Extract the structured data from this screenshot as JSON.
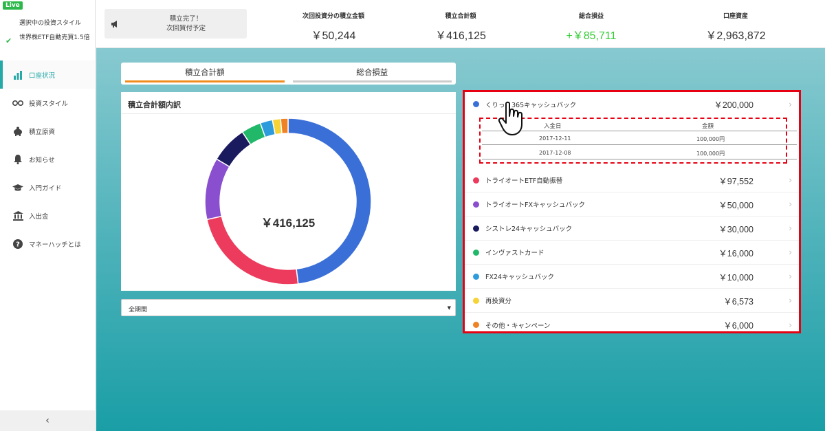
{
  "sidebar": {
    "live_badge": "Live",
    "style_label": "選択中の投資スタイル",
    "style_value": "世界株ETF自動売買1.5倍",
    "items": [
      {
        "label": "口座状況",
        "icon": "bar-chart-icon",
        "active": true
      },
      {
        "label": "投資スタイル",
        "icon": "glasses-icon"
      },
      {
        "label": "積立原資",
        "icon": "piggy-bank-icon"
      },
      {
        "label": "お知らせ",
        "icon": "bell-icon"
      },
      {
        "label": "入門ガイド",
        "icon": "graduation-cap-icon"
      },
      {
        "label": "入出金",
        "icon": "bank-icon"
      },
      {
        "label": "マネーハッチとは",
        "icon": "question-icon"
      }
    ],
    "collapse_glyph": "‹"
  },
  "header": {
    "notice_line1": "積立完了！",
    "notice_line2": "次回買付予定",
    "stats": [
      {
        "label": "次回投資分の積立金額",
        "value": "￥50,244"
      },
      {
        "label": "積立合計額",
        "value": "￥416,125"
      },
      {
        "label": "総合損益",
        "value": "+￥85,711",
        "color": "#33cc33"
      },
      {
        "label": "口座資産",
        "value": "￥2,963,872"
      }
    ]
  },
  "tabs": [
    {
      "label": "積立合計額",
      "active": true
    },
    {
      "label": "総合損益",
      "active": false
    }
  ],
  "chart_title": "積立合計額内訳",
  "period_select": {
    "value": "全期間"
  },
  "chart_data": {
    "type": "pie",
    "center_label": "￥416,125",
    "categories": [
      "くりっく365キャッシュバック",
      "トライオートETF自動振替",
      "トライオートFXキャッシュバック",
      "シストレ24キャッシュバック",
      "インヴァストカード",
      "FX24キャッシュバック",
      "再投資分",
      "その他・キャンペーン"
    ],
    "values": [
      200000,
      97552,
      50000,
      30000,
      16000,
      10000,
      6573,
      6000
    ],
    "colors": [
      "#3b6fd8",
      "#ec3b5c",
      "#8a4fcf",
      "#1a1a5e",
      "#22b86a",
      "#2e9bdc",
      "#f7d336",
      "#f08226"
    ]
  },
  "list": {
    "items": [
      {
        "name": "くりっく365キャッシュバック",
        "amount": "￥200,000",
        "color": "#3b6fd8"
      },
      {
        "name": "トライオートETF自動振替",
        "amount": "￥97,552",
        "color": "#ec3b5c"
      },
      {
        "name": "トライオートFXキャッシュバック",
        "amount": "￥50,000",
        "color": "#8a4fcf"
      },
      {
        "name": "シストレ24キャッシュバック",
        "amount": "￥30,000",
        "color": "#1a1a5e"
      },
      {
        "name": "インヴァストカード",
        "amount": "￥16,000",
        "color": "#22b86a"
      },
      {
        "name": "FX24キャッシュバック",
        "amount": "￥10,000",
        "color": "#2e9bdc"
      },
      {
        "name": "再投資分",
        "amount": "￥6,573",
        "color": "#f7d336"
      },
      {
        "name": "その他・キャンペーン",
        "amount": "￥6,000",
        "color": "#f08226"
      }
    ],
    "detail": {
      "header_date": "入金日",
      "header_amount": "金額",
      "rows": [
        {
          "date": "2017-12-11",
          "amount": "100,000円"
        },
        {
          "date": "2017-12-08",
          "amount": "100,000円"
        }
      ]
    }
  }
}
